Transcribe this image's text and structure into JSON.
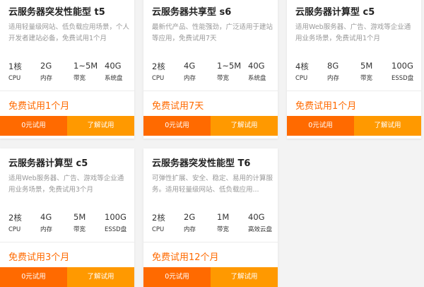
{
  "accent_color": "#ff6a00",
  "secondary_color": "#ff9900",
  "cards": [
    {
      "title": "云服务器突发性能型 t5",
      "desc": "适用轻量级网站、低负载应用场景，个人开发者建站必备，免费试用1个月",
      "specs": [
        {
          "value": "1核",
          "label": "CPU"
        },
        {
          "value": "2G",
          "label": "内存"
        },
        {
          "value": "1~5M",
          "label": "带宽"
        },
        {
          "value": "40G",
          "label": "系统盘"
        }
      ],
      "trial": "免费试用1个月",
      "btn_try": "0元试用",
      "btn_learn": "了解试用"
    },
    {
      "title": "云服务器共享型 s6",
      "desc": "最新代产品、性能强劲，广泛适用于建站等应用，免费试用7天",
      "specs": [
        {
          "value": "2核",
          "label": "CPU"
        },
        {
          "value": "4G",
          "label": "内存"
        },
        {
          "value": "1~5M",
          "label": "带宽"
        },
        {
          "value": "40G",
          "label": "系统盘"
        }
      ],
      "trial": "免费试用7天",
      "btn_try": "0元试用",
      "btn_learn": "了解试用"
    },
    {
      "title": "云服务器计算型 c5",
      "desc": "适用Web服务器、广告、游戏等企业通用业务场景，免费试用1个月",
      "specs": [
        {
          "value": "4核",
          "label": "CPU"
        },
        {
          "value": "8G",
          "label": "内存"
        },
        {
          "value": "5M",
          "label": "带宽"
        },
        {
          "value": "100G",
          "label": "ESSD盘"
        }
      ],
      "trial": "免费试用1个月",
      "btn_try": "0元试用",
      "btn_learn": "了解试用"
    },
    {
      "title": "云服务器计算型 c5",
      "desc": "适用Web服务器、广告、游戏等企业通用业务场景，免费试用3个月",
      "specs": [
        {
          "value": "2核",
          "label": "CPU"
        },
        {
          "value": "4G",
          "label": "内存"
        },
        {
          "value": "5M",
          "label": "带宽"
        },
        {
          "value": "100G",
          "label": "ESSD盘"
        }
      ],
      "trial": "免费试用3个月",
      "btn_try": "0元试用",
      "btn_learn": "了解试用"
    },
    {
      "title": "云服务器突发性能型 T6",
      "desc": "可弹性扩展、安全、稳定、易用的计算服务。适用轻量级网站、低负载应用...",
      "specs": [
        {
          "value": "2核",
          "label": "CPU"
        },
        {
          "value": "2G",
          "label": "内存"
        },
        {
          "value": "1M",
          "label": "带宽"
        },
        {
          "value": "40G",
          "label": "高效云盘"
        }
      ],
      "trial": "免费试用12个月",
      "btn_try": "0元试用",
      "btn_learn": "了解试用"
    }
  ]
}
